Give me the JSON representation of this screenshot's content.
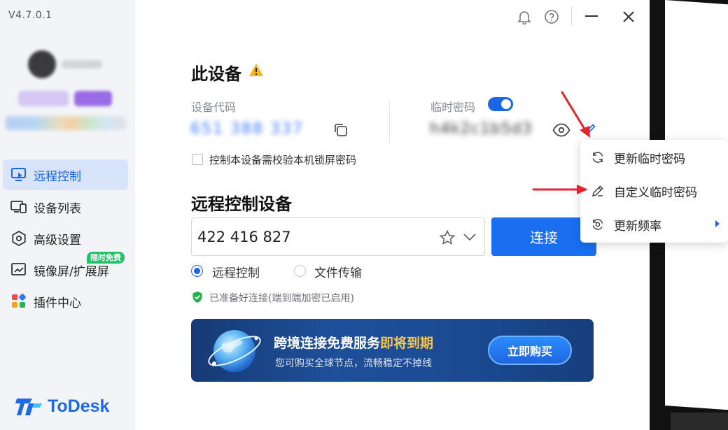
{
  "app": {
    "version": "V4.7.0.1",
    "brand": "ToDesk",
    "accent_color": "#1a66e8"
  },
  "sidebar": {
    "items": [
      {
        "label": "远程控制",
        "icon": "remote-control-icon",
        "active": true
      },
      {
        "label": "设备列表",
        "icon": "device-list-icon",
        "active": false
      },
      {
        "label": "高级设置",
        "icon": "settings-hexagon-icon",
        "active": false
      },
      {
        "label": "镜像屏/扩展屏",
        "icon": "mirror-screen-icon",
        "active": false
      },
      {
        "label": "插件中心",
        "icon": "plugin-grid-icon",
        "active": false
      }
    ],
    "promo_tag": "限时免费"
  },
  "titlebar": {
    "icons": [
      "bell-icon",
      "help-icon",
      "minimize-icon",
      "close-icon"
    ]
  },
  "this_device": {
    "title": "此设备",
    "warning_icon": "warning-icon",
    "device_code_label": "设备代码",
    "device_code_value": "651 388 337",
    "temp_password_label": "临时密码",
    "temp_password_value": "h4k2c1b5d3",
    "temp_password_enabled": true,
    "lock_password_checkbox_label": "控制本设备需校验本机锁屏密码",
    "lock_password_checked": false
  },
  "remote": {
    "title": "远程控制设备",
    "device_id_value": "422 416 827",
    "connect_label": "连接",
    "mode_options": [
      {
        "label": "远程控制",
        "selected": true
      },
      {
        "label": "文件传输",
        "selected": false
      }
    ],
    "status": "已准备好连接(端到端加密已启用)"
  },
  "banner": {
    "title_part1": "跨境连接免费服务",
    "title_highlight": "即将到期",
    "subtitle": "您可购买全球节点，流畅稳定不掉线",
    "buy_label": "立即购买",
    "highlight_color": "#f7c64a"
  },
  "password_menu": {
    "items": [
      {
        "label": "更新临时密码",
        "icon": "refresh-icon"
      },
      {
        "label": "自定义临时密码",
        "icon": "pencil-icon"
      },
      {
        "label": "更新频率",
        "icon": "refresh-frequency-icon",
        "has_submenu": true
      }
    ]
  },
  "annotation_color": "#e0262b"
}
